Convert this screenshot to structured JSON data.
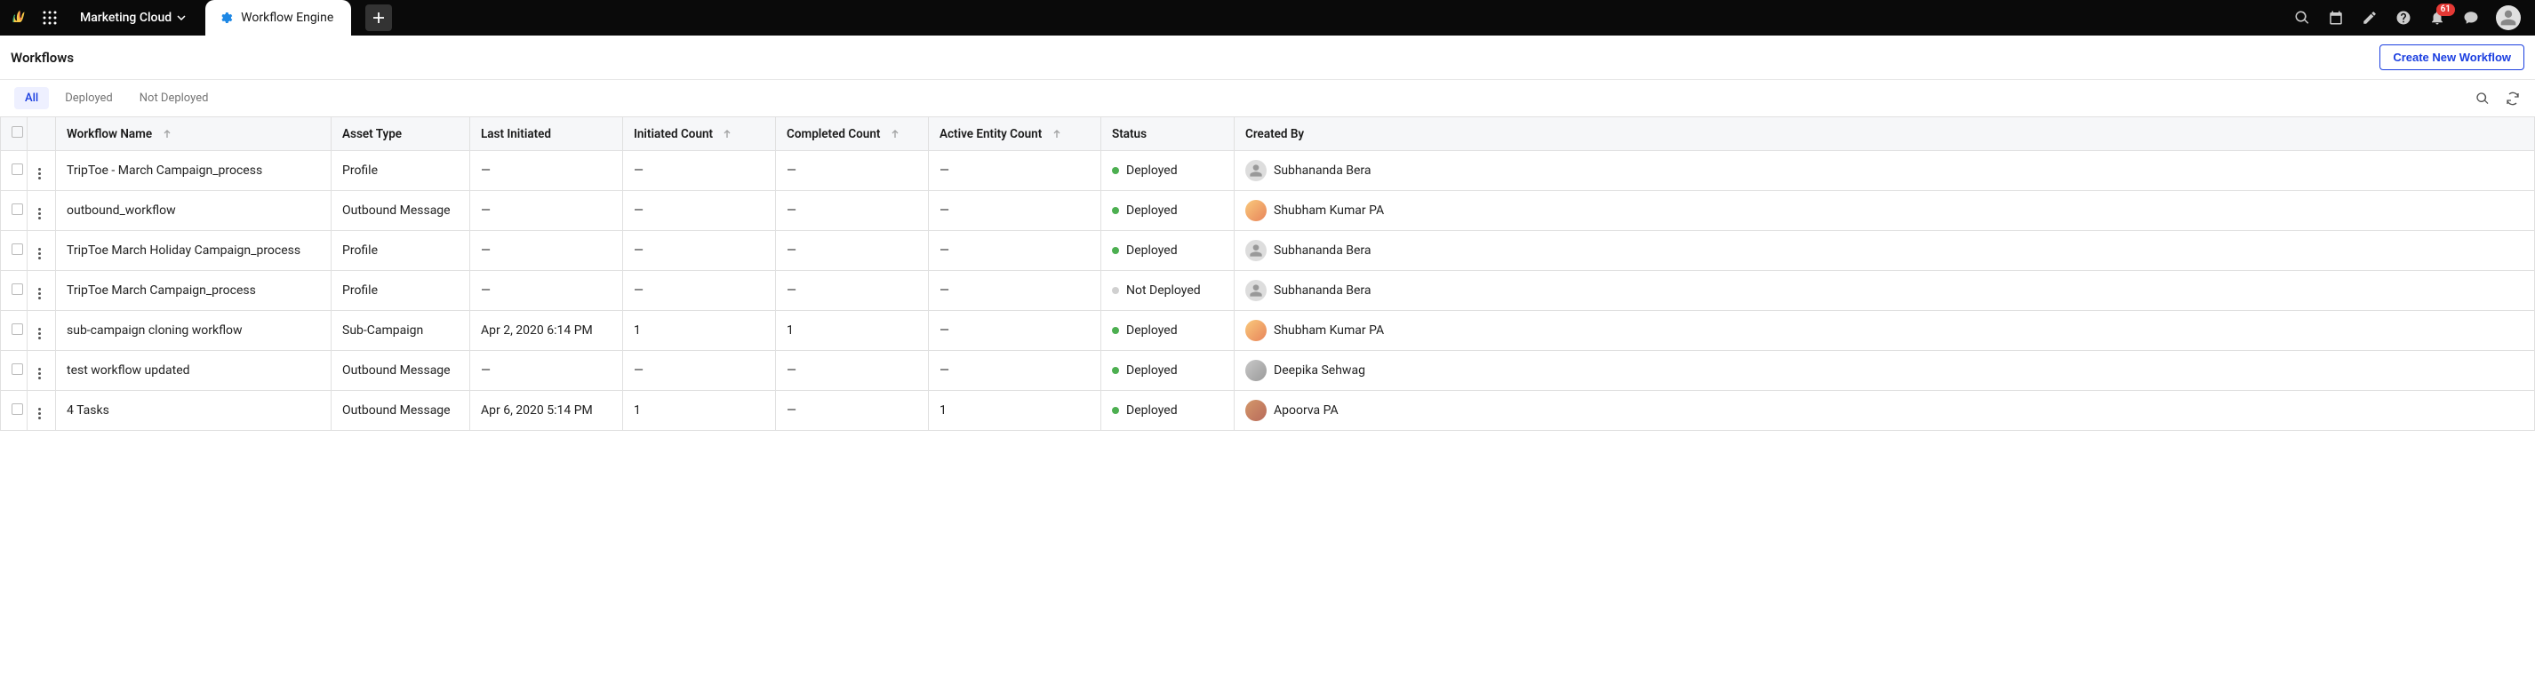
{
  "topbar": {
    "workspace_name": "Marketing Cloud",
    "active_tab": "Workflow Engine",
    "notification_count": "61"
  },
  "page": {
    "title": "Workflows",
    "create_button": "Create New Workflow"
  },
  "filters": {
    "all": "All",
    "deployed": "Deployed",
    "not_deployed": "Not Deployed"
  },
  "columns": {
    "name": "Workflow Name",
    "asset_type": "Asset Type",
    "last_initiated": "Last Initiated",
    "initiated_count": "Initiated Count",
    "completed_count": "Completed Count",
    "active_entity_count": "Active Entity Count",
    "status": "Status",
    "created_by": "Created By"
  },
  "status_labels": {
    "deployed": "Deployed",
    "not_deployed": "Not Deployed"
  },
  "rows": [
    {
      "name": "TripToe - March Campaign_process",
      "asset_type": "Profile",
      "last_initiated": "—",
      "initiated_count": "—",
      "completed_count": "—",
      "active_entity_count": "—",
      "status": "deployed",
      "created_by": "Subhananda Bera",
      "avatar": "default"
    },
    {
      "name": "outbound_workflow",
      "asset_type": "Outbound Message",
      "last_initiated": "—",
      "initiated_count": "—",
      "completed_count": "—",
      "active_entity_count": "—",
      "status": "deployed",
      "created_by": "Shubham Kumar PA",
      "avatar": "orange"
    },
    {
      "name": "TripToe March Holiday Campaign_process",
      "asset_type": "Profile",
      "last_initiated": "—",
      "initiated_count": "—",
      "completed_count": "—",
      "active_entity_count": "—",
      "status": "deployed",
      "created_by": "Subhananda Bera",
      "avatar": "default"
    },
    {
      "name": "TripToe March Campaign_process",
      "asset_type": "Profile",
      "last_initiated": "—",
      "initiated_count": "—",
      "completed_count": "—",
      "active_entity_count": "—",
      "status": "not_deployed",
      "created_by": "Subhananda Bera",
      "avatar": "default"
    },
    {
      "name": "sub-campaign cloning workflow",
      "asset_type": "Sub-Campaign",
      "last_initiated": "Apr 2, 2020 6:14 PM",
      "initiated_count": "1",
      "completed_count": "1",
      "active_entity_count": "—",
      "status": "deployed",
      "created_by": "Shubham Kumar PA",
      "avatar": "orange"
    },
    {
      "name": "test workflow updated",
      "asset_type": "Outbound Message",
      "last_initiated": "—",
      "initiated_count": "—",
      "completed_count": "—",
      "active_entity_count": "—",
      "status": "deployed",
      "created_by": "Deepika Sehwag",
      "avatar": "gray"
    },
    {
      "name": "4 Tasks",
      "asset_type": "Outbound Message",
      "last_initiated": "Apr 6, 2020 5:14 PM",
      "initiated_count": "1",
      "completed_count": "—",
      "active_entity_count": "1",
      "status": "deployed",
      "created_by": "Apoorva PA",
      "avatar": "red"
    }
  ]
}
